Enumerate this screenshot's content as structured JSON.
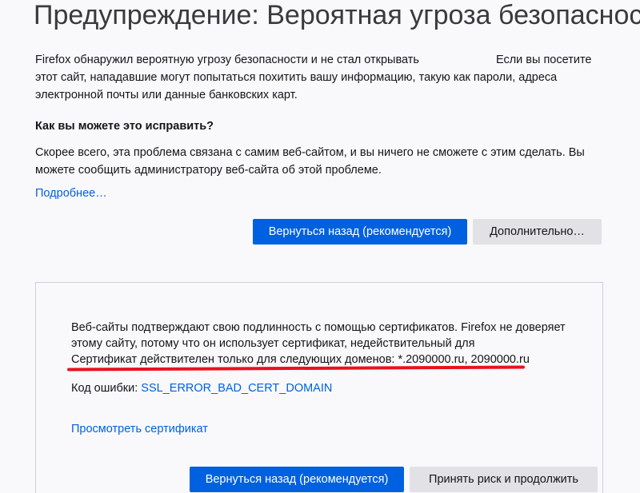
{
  "header": {
    "title": "Предупреждение: Вероятная угроза безопасности"
  },
  "intro": {
    "text_part1": "Firefox обнаружил вероятную угрозу безопасности и не стал открывать",
    "text_part2": "Если вы посетите этот сайт, нападавшие могут попытаться похитить вашу информацию, такую как пароли, адреса электронной почты или данные банковских карт."
  },
  "fix": {
    "heading": "Как вы можете это исправить?",
    "text": "Скорее всего, эта проблема связана с самим веб-сайтом, и вы ничего не сможете с этим сделать. Вы можете сообщить администратору веб-сайта об этой проблеме.",
    "learn_more": "Подробнее…"
  },
  "actions": {
    "go_back": "Вернуться назад (рекомендуется)",
    "advanced": "Дополнительно…"
  },
  "advanced_panel": {
    "text_line1": "Веб-сайты подтверждают свою подлинность с помощью сертификатов. Firefox не доверяет этому сайту, потому что он использует сертификат, недействительный для",
    "text_line2": "Сертификат действителен только для следующих доменов: *.2090000.ru, 2090000.ru",
    "error_label": "Код ошибки:",
    "error_code": "SSL_ERROR_BAD_CERT_DOMAIN",
    "view_certificate": "Просмотреть сертификат",
    "go_back": "Вернуться назад (рекомендуется)",
    "accept_risk": "Принять риск и продолжить"
  },
  "colors": {
    "primary_button": "#0061e0",
    "secondary_button": "#e2e2e6",
    "link": "#0060df",
    "annotation_underline": "#e8121e"
  }
}
